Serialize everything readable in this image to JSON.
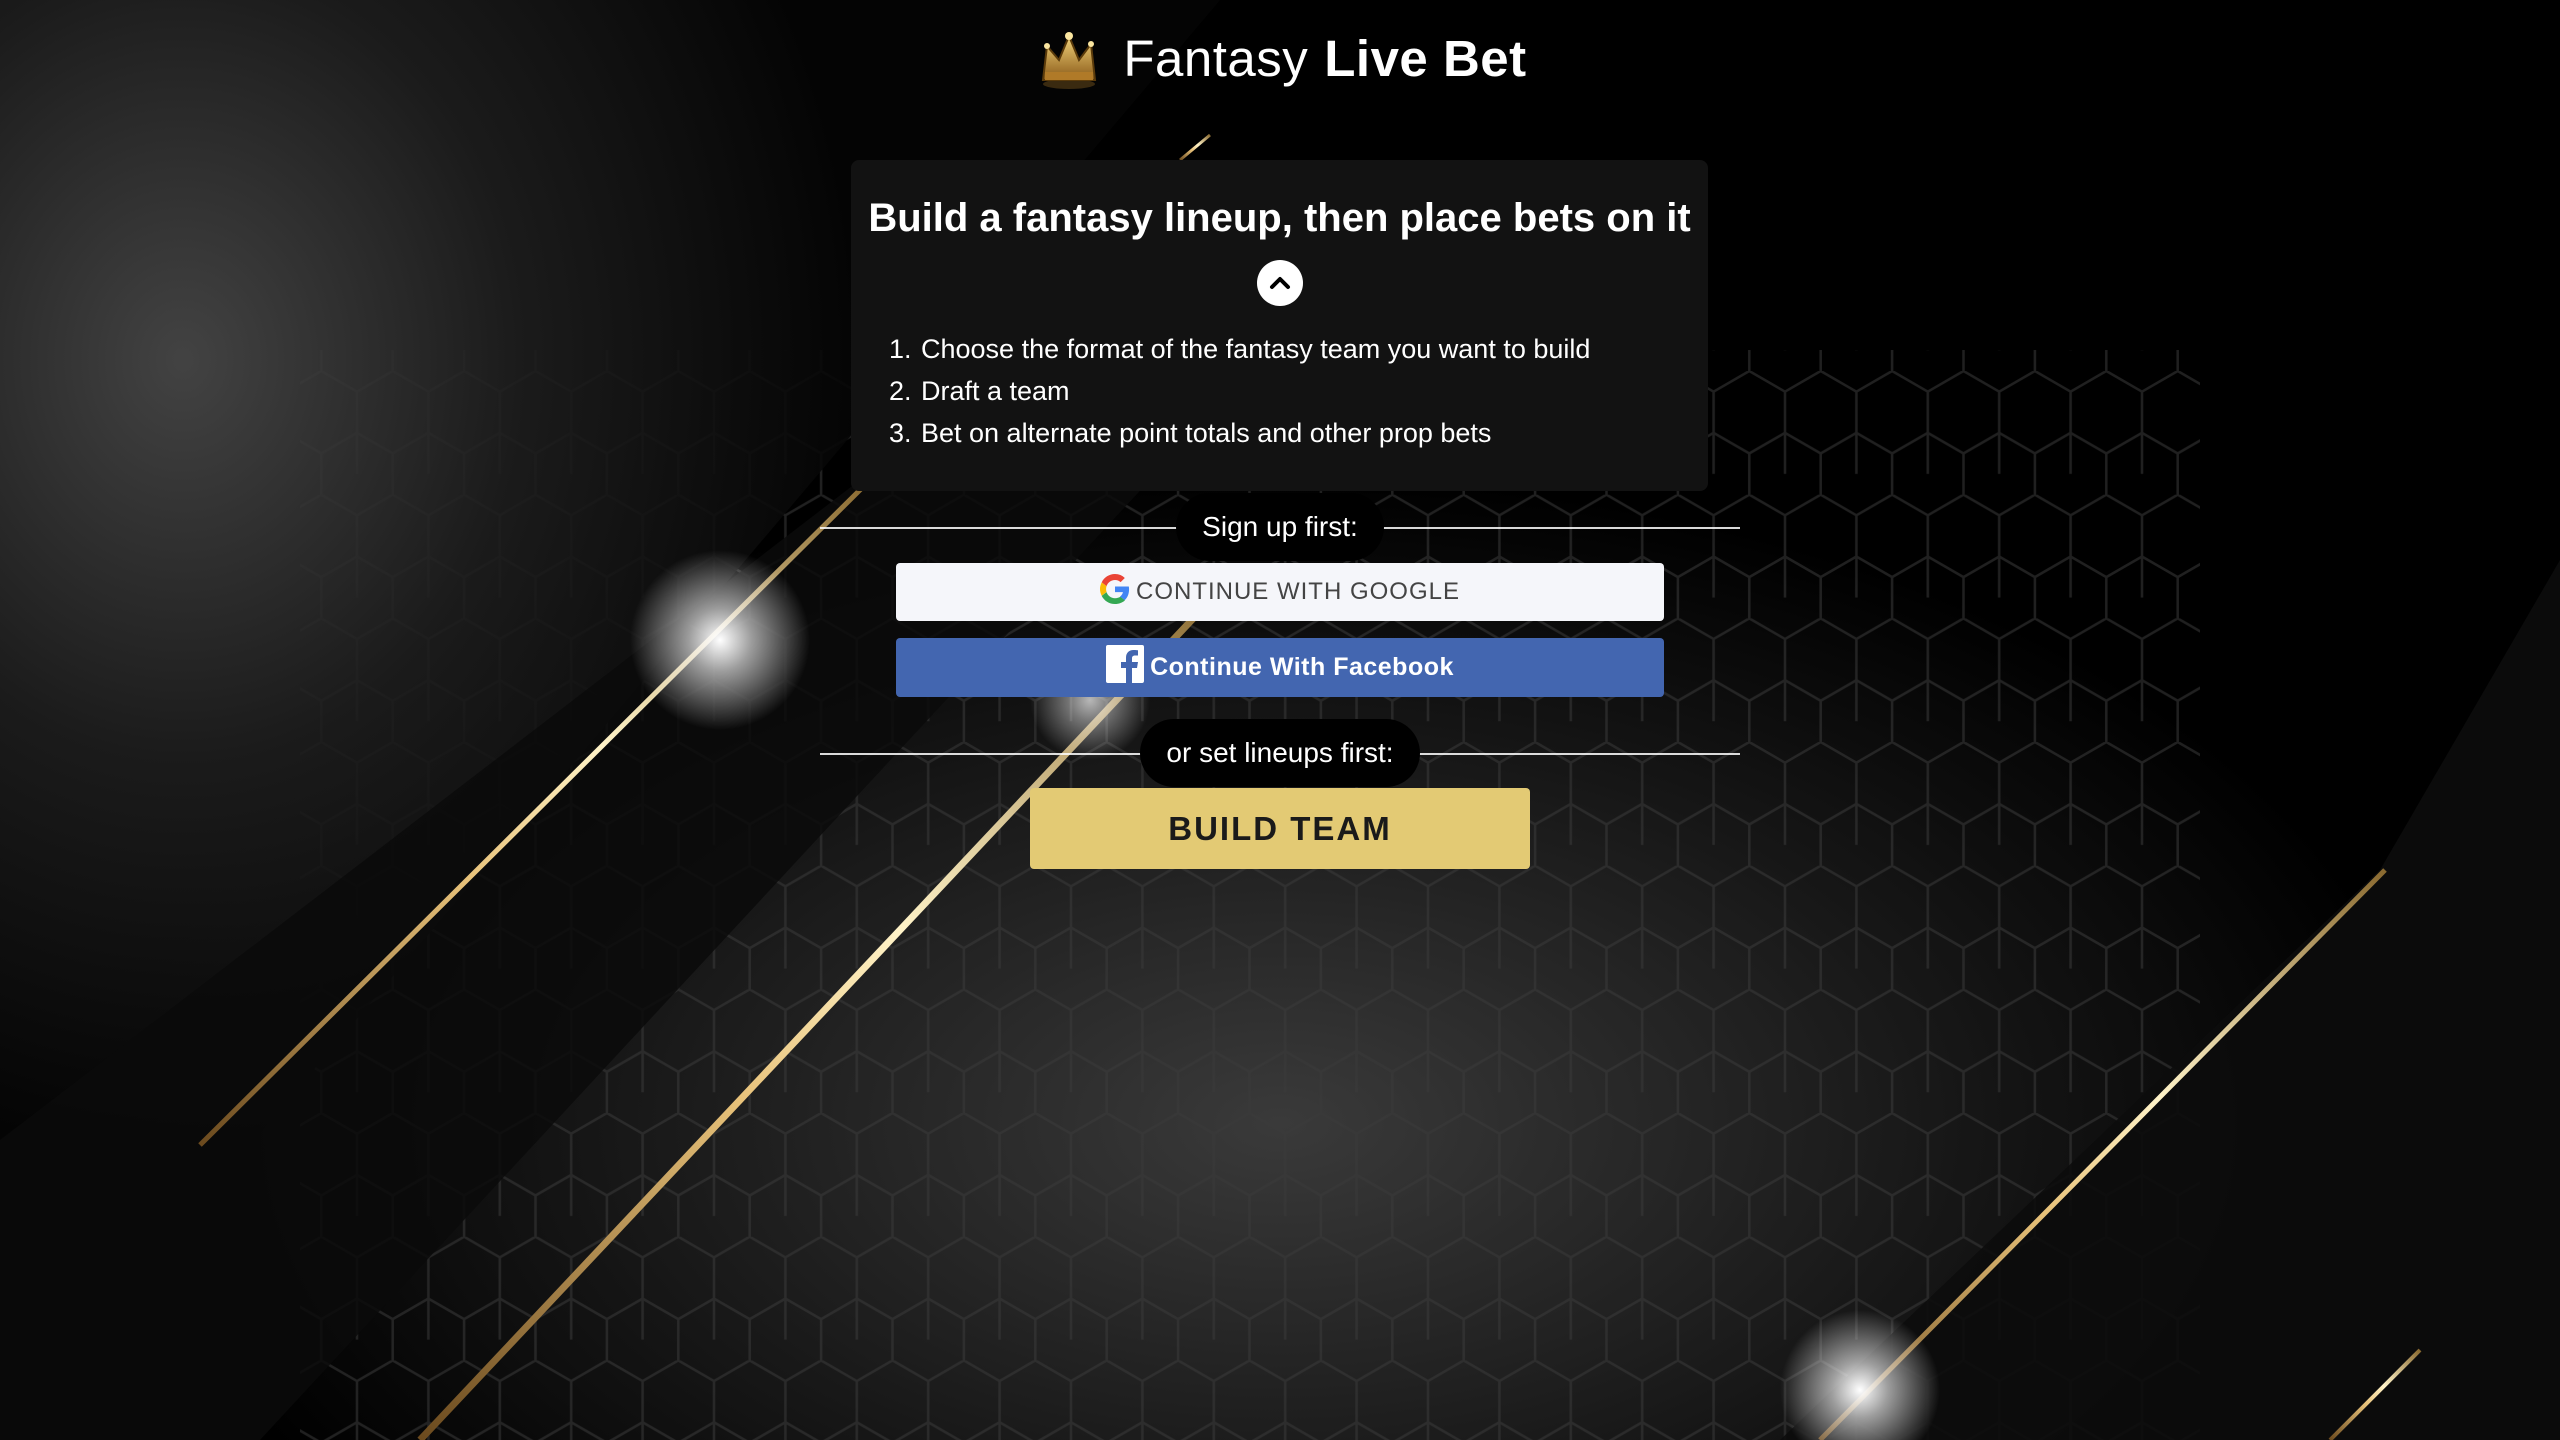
{
  "brand": {
    "name_light": "Fantasy",
    "name_bold": "Live Bet",
    "logo_icon": "crown-icon"
  },
  "card": {
    "title": "Build a fantasy lineup, then place bets on it",
    "collapse_icon": "chevron-up-icon",
    "steps": [
      {
        "num": "1.",
        "text": "Choose the format of the fantasy team you want to build"
      },
      {
        "num": "2.",
        "text": "Draft a team"
      },
      {
        "num": "3.",
        "text": "Bet on alternate point totals and other prop bets"
      }
    ]
  },
  "signup": {
    "label": "Sign up first:",
    "google_label": "CONTINUE WITH GOOGLE",
    "google_icon": "google-icon",
    "facebook_label": "Continue With Facebook",
    "facebook_icon": "facebook-icon"
  },
  "lineup": {
    "label": "or set lineups first:",
    "build_label": "BUILD TEAM"
  },
  "colors": {
    "accent_gold": "#e3ca74",
    "facebook_blue": "#4366b0",
    "card_bg": "#121212"
  }
}
